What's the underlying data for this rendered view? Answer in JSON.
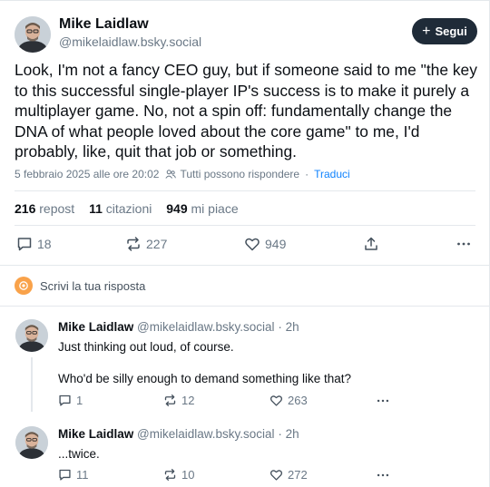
{
  "post": {
    "author_name": "Mike Laidlaw",
    "author_handle": "@mikelaidlaw.bsky.social",
    "follow_label": "Segui",
    "text": "Look, I'm not a fancy CEO guy, but if someone said to me \"the key to this successful  single-player IP's success is to make it purely a multiplayer game. No, not a spin off: fundamentally change the DNA of what people loved about the core game\" to me, I'd probably, like, quit that job or something.",
    "timestamp": "5 febbraio 2025 alle ore 20:02",
    "reply_setting": "Tutti possono rispondere",
    "separator": "·",
    "translate_label": "Traduci",
    "stats": {
      "reposts_count": "216",
      "reposts_label": "repost",
      "quotes_count": "11",
      "quotes_label": "citazioni",
      "likes_count": "949",
      "likes_label": "mi piace"
    },
    "actions": {
      "replies": "18",
      "reposts": "227",
      "likes": "949",
      "share_icon": "share-icon",
      "more_icon": "more-icon"
    }
  },
  "compose": {
    "placeholder": "Scrivi la tua risposta"
  },
  "replies": [
    {
      "author_name": "Mike Laidlaw",
      "author_handle": "@mikelaidlaw.bsky.social",
      "age": "· 2h",
      "line1": "Just thinking out loud, of course.",
      "line2": "Who'd be silly enough to demand something like that?",
      "replies": "1",
      "reposts": "12",
      "likes": "263"
    },
    {
      "author_name": "Mike Laidlaw",
      "author_handle": "@mikelaidlaw.bsky.social",
      "age": "· 2h",
      "line1": "...twice.",
      "replies": "11",
      "reposts": "10",
      "likes": "272"
    }
  ],
  "colors": {
    "accent": "#1083fe",
    "muted": "#6a7886",
    "follow_bg": "#1f2b38",
    "compose_avatar": "#f9a24a"
  }
}
